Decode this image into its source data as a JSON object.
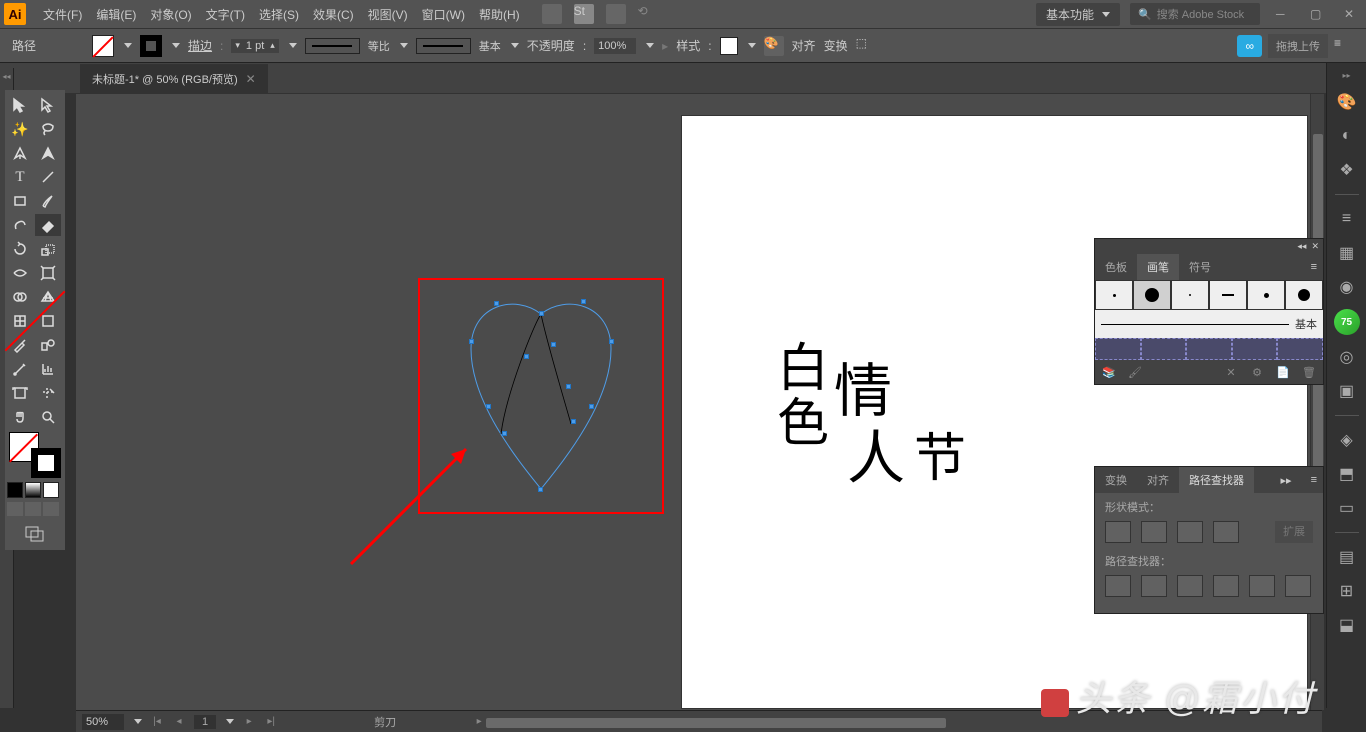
{
  "menubar": {
    "items": [
      "文件(F)",
      "编辑(E)",
      "对象(O)",
      "文字(T)",
      "选择(S)",
      "效果(C)",
      "视图(V)",
      "窗口(W)",
      "帮助(H)"
    ],
    "workspace": "基本功能",
    "search_placeholder": "搜索 Adobe Stock"
  },
  "controlbar": {
    "selection": "路径",
    "stroke_label": "描边",
    "stroke_weight": "1 pt",
    "profile": "等比",
    "brush": "基本",
    "opacity_label": "不透明度",
    "opacity": "100%",
    "style_label": "样式",
    "align_label": "对齐",
    "transform_label": "变换",
    "upload_label": "拖拽上传"
  },
  "tab": {
    "title": "未标题-1* @ 50% (RGB/预览)"
  },
  "artboard_text": {
    "c1": "白",
    "c2": "色",
    "c3": "情",
    "c4": "人",
    "c5": "节"
  },
  "brushes_panel": {
    "tabs": [
      "色板",
      "画笔",
      "符号"
    ],
    "basic_label": "基本"
  },
  "pathfinder_panel": {
    "tabs": [
      "变换",
      "对齐",
      "路径查找器"
    ],
    "shape_mode": "形状模式：",
    "pathfinder": "路径查找器：",
    "expand": "扩展"
  },
  "statusbar": {
    "zoom": "50%",
    "page": "1",
    "tool": "剪刀"
  },
  "watermark": "头条 @霜小付"
}
